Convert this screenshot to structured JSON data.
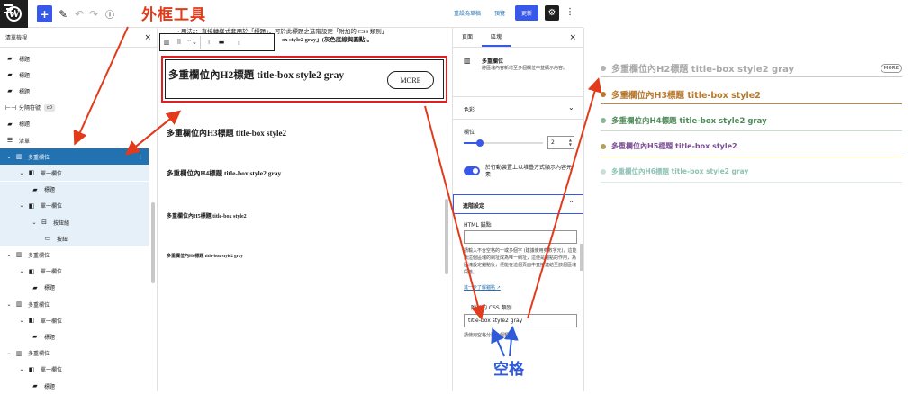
{
  "toolbar": {
    "wp_logo": "W",
    "add_label": "+",
    "pen_icon": "✎",
    "undo_icon": "↶",
    "redo_icon": "↷",
    "info_icon": "ⓘ",
    "outline_annotation": "外框工具",
    "switch_draft": "重設為草稿",
    "preview": "預覽",
    "update": "更新",
    "gear_icon": "⚙",
    "more_icon": "⋮"
  },
  "list_view": {
    "title": "清單檢視",
    "close": "×",
    "items": [
      {
        "icon": "bookmark-icon",
        "glyph": "▰",
        "label": "標題"
      },
      {
        "icon": "bookmark-icon",
        "glyph": "▰",
        "label": "標題"
      },
      {
        "icon": "bookmark-icon",
        "glyph": "▰",
        "label": "標題"
      },
      {
        "icon": "separator-icon",
        "glyph": "⊢⊣",
        "label": "分隔符號",
        "badge": "c0"
      },
      {
        "icon": "bookmark-icon",
        "glyph": "▰",
        "label": "標題"
      },
      {
        "icon": "list-icon",
        "glyph": "☰",
        "label": "清單"
      },
      {
        "icon": "columns-icon",
        "glyph": "▥",
        "label": "多重欄位",
        "chev": "⌄",
        "more": "⋮"
      },
      {
        "icon": "column-icon",
        "glyph": "◧",
        "label": "單一欄位",
        "chev": "⌄"
      },
      {
        "icon": "bookmark-icon",
        "glyph": "▰",
        "label": "標題"
      },
      {
        "icon": "column-icon",
        "glyph": "◧",
        "label": "單一欄位",
        "chev": "⌄"
      },
      {
        "icon": "buttons-icon",
        "glyph": "⊟",
        "label": "按鈕組",
        "chev": "⌄"
      },
      {
        "icon": "button-icon",
        "glyph": "▭",
        "label": "按鈕"
      },
      {
        "icon": "columns-icon",
        "glyph": "▥",
        "label": "多重欄位",
        "chev": "⌄"
      },
      {
        "icon": "column-icon",
        "glyph": "◧",
        "label": "單一欄位",
        "chev": "⌄"
      },
      {
        "icon": "bookmark-icon",
        "glyph": "▰",
        "label": "標題"
      },
      {
        "icon": "columns-icon",
        "glyph": "▥",
        "label": "多重欄位",
        "chev": "⌄"
      },
      {
        "icon": "column-icon",
        "glyph": "◧",
        "label": "單一欄位",
        "chev": "⌄"
      },
      {
        "icon": "bookmark-icon",
        "glyph": "▰",
        "label": "標題"
      },
      {
        "icon": "columns-icon",
        "glyph": "▥",
        "label": "多重欄位",
        "chev": "⌄"
      },
      {
        "icon": "column-icon",
        "glyph": "◧",
        "label": "單一欄位",
        "chev": "⌄"
      },
      {
        "icon": "bookmark-icon",
        "glyph": "▰",
        "label": "標題"
      }
    ]
  },
  "canvas": {
    "intro_line": "• 用法2：直接轉樣式套用於「標題」，可於此標題之進階設定「附加的 CSS 類別」",
    "intro_line2": "ox style2 gray」(灰色底線與圓點)。",
    "block_toolbar": [
      "▥",
      "⠿",
      "⌃⌄",
      "⊤",
      "▬",
      "⋮"
    ],
    "h2": "多重欄位內H2標題 title-box style2 gray",
    "more_button": "MORE",
    "h3": "多重欄位內H3標題 title-box style2",
    "h4": "多重欄位內H4標題 title-box style2 gray",
    "h5": "多重欄位內H5標題 title-box style2",
    "h6": "多重欄位內H6標題 title-box style2 gray"
  },
  "settings": {
    "tab_page": "頁面",
    "tab_block": "區塊",
    "close": "×",
    "block_icon": "▥",
    "block_name": "多重欄位",
    "block_desc": "將區塊內容新增至多個欄位中並顯示內容。",
    "color": "色彩",
    "color_chev": "⌄",
    "columns_label": "欄位",
    "columns_value": "2",
    "columns_level": 0.2,
    "stack_label": "於行動裝置上以堆疊方式顯示內容元素",
    "advanced": "進階設定",
    "advanced_chev": "⌃",
    "html_anchor": "HTML 錨點",
    "anchor_help": "請輸入不含空格的一或多個字 (建議使用英數字元)，這能讓這個區塊的網址成為唯一網址，這便是錨點的作用，為區塊設定錨點後，便能在這個頁面中直接連結至該個區塊段落。",
    "learn_more": "進一步了解錨點 ↗",
    "css_label": "附加的 CSS 類別",
    "css_value": "title-box style2 gray",
    "css_help": "請使用空格分隔多個類別。",
    "space_annotation": "空格"
  },
  "preview": {
    "headings": [
      {
        "level": "H2",
        "text": "多重欄位內H2標題 title-box style2 gray",
        "color": "#a9a9a9",
        "dot": "#b3b3b3",
        "line": "#cccccc",
        "badge": "MORE"
      },
      {
        "level": "H3",
        "text": "多重欄位內H3標題 title-box style2",
        "color": "#b8792d",
        "dot": "#b8792d",
        "line": "#c58a3e"
      },
      {
        "level": "H4",
        "text": "多重欄位內H4標題 title-box style2 gray",
        "color": "#4e8a5a",
        "dot": "#8cb596",
        "line": "#c9dccc"
      },
      {
        "level": "H5",
        "text": "多重欄位內H5標題 title-box style2",
        "color": "#7b4d93",
        "dot": "#b0a060",
        "line": "#cdbd6e"
      },
      {
        "level": "H6",
        "text": "多重欄位內H6標題 title-box style2 gray",
        "color": "#8ec2b4",
        "dot": "#c8ded9",
        "line": "#dcebe7"
      }
    ]
  },
  "colors": {
    "annotation_red": "#e23a1a",
    "annotation_blue": "#2f5bd8",
    "wp_blue": "#3858e9",
    "selected_blue": "#2271b1"
  }
}
